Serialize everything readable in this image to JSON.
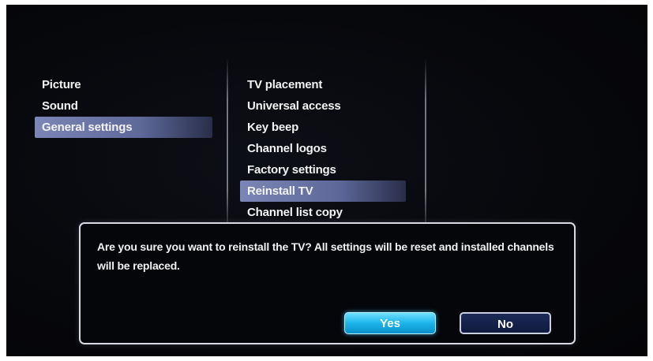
{
  "menu": {
    "level1": [
      {
        "label": "Picture",
        "selected": false
      },
      {
        "label": "Sound",
        "selected": false
      },
      {
        "label": "General settings",
        "selected": true
      }
    ],
    "level2": [
      {
        "label": "TV placement",
        "selected": false
      },
      {
        "label": "Universal access",
        "selected": false
      },
      {
        "label": "Key beep",
        "selected": false
      },
      {
        "label": "Channel logos",
        "selected": false
      },
      {
        "label": "Factory settings",
        "selected": false
      },
      {
        "label": "Reinstall TV",
        "selected": true
      },
      {
        "label": "Channel list copy",
        "selected": false
      }
    ]
  },
  "dialog": {
    "message": "Are you sure you want to reinstall the TV? All settings will be reset and installed channels will be replaced.",
    "yes_label": "Yes",
    "no_label": "No",
    "focused_button": "Yes"
  },
  "colors": {
    "selection": "#6d78a8",
    "focus_button": "#1cb4ea",
    "secondary_button": "#101a3e"
  }
}
